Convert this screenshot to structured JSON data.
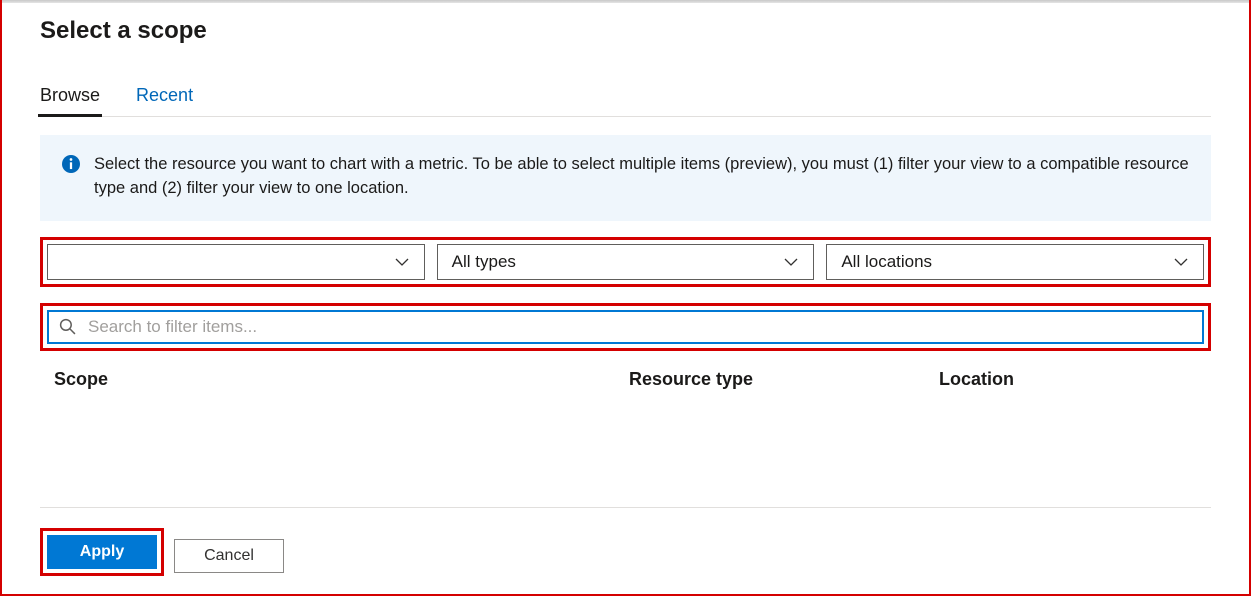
{
  "dialog": {
    "title": "Select a scope"
  },
  "tabs": {
    "browse": "Browse",
    "recent": "Recent"
  },
  "info": {
    "text": "Select the resource you want to chart with a metric. To be able to select multiple items (preview), you must (1) filter your view to a compatible resource type and (2) filter your view to one location."
  },
  "filters": {
    "subscription": {
      "label": ""
    },
    "types": {
      "label": "All types"
    },
    "locations": {
      "label": "All locations"
    }
  },
  "search": {
    "placeholder": "Search to filter items...",
    "value": ""
  },
  "columns": {
    "scope": "Scope",
    "resource_type": "Resource type",
    "location": "Location"
  },
  "buttons": {
    "apply": "Apply",
    "cancel": "Cancel"
  },
  "colors": {
    "primary": "#0078d4",
    "highlight_border": "#d40000",
    "info_bg": "#eff6fc"
  }
}
